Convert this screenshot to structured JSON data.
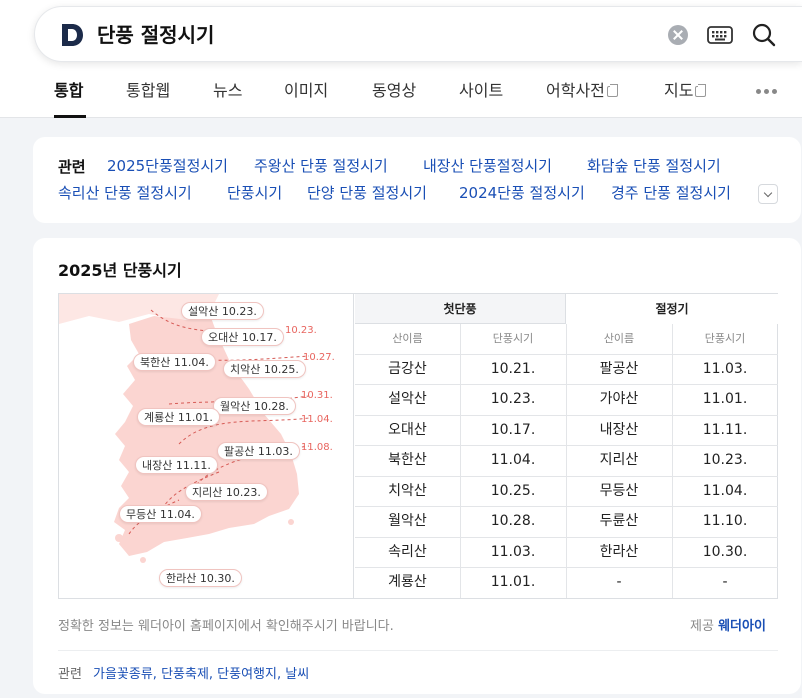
{
  "search": {
    "query": "단풍 절정시기"
  },
  "tabs": [
    {
      "label": "통합"
    },
    {
      "label": "통합웹"
    },
    {
      "label": "뉴스"
    },
    {
      "label": "이미지"
    },
    {
      "label": "동영상"
    },
    {
      "label": "사이트"
    },
    {
      "label": "어학사전"
    },
    {
      "label": "지도"
    }
  ],
  "related": {
    "label": "관련",
    "links": [
      "2025단풍절정시기",
      "주왕산 단풍 절정시기",
      "내장산 단풍절정시기",
      "화담숲 단풍 절정시기",
      "속리산 단풍 절정시기",
      "단풍시기",
      "단양 단풍 절정시기",
      "2024단풍 절정시기",
      "경주 단풍 절정시기"
    ]
  },
  "foliage": {
    "title": "2025년 단풍시기",
    "map_pins": [
      "설악산 10.23.",
      "오대산 10.17.",
      "북한산 11.04.",
      "치악산 10.25.",
      "월악산 10.28.",
      "계룡산 11.01.",
      "팔공산 11.03.",
      "내장산 11.11.",
      "지리산 10.23.",
      "무등산 11.04.",
      "한라산 10.30."
    ],
    "isolines": [
      "10.23.",
      "10.27.",
      "10.31.",
      "11.04.",
      "11.08."
    ],
    "table": {
      "group_first": "첫단풍",
      "group_peak": "절정기",
      "col_mountain": "산이름",
      "col_date": "단풍시기",
      "rows": [
        {
          "m1": "금강산",
          "d1": "10.21.",
          "m2": "팔공산",
          "d2": "11.03."
        },
        {
          "m1": "설악산",
          "d1": "10.23.",
          "m2": "가야산",
          "d2": "11.01."
        },
        {
          "m1": "오대산",
          "d1": "10.17.",
          "m2": "내장산",
          "d2": "11.11."
        },
        {
          "m1": "북한산",
          "d1": "11.04.",
          "m2": "지리산",
          "d2": "10.23."
        },
        {
          "m1": "치악산",
          "d1": "10.25.",
          "m2": "무등산",
          "d2": "11.04."
        },
        {
          "m1": "월악산",
          "d1": "10.28.",
          "m2": "두륜산",
          "d2": "11.10."
        },
        {
          "m1": "속리산",
          "d1": "11.03.",
          "m2": "한라산",
          "d2": "10.30."
        },
        {
          "m1": "계룡산",
          "d1": "11.01.",
          "m2": "-",
          "d2": "-"
        }
      ]
    },
    "notice": "정확한 정보는 웨더아이 홈페이지에서 확인해주시기 바랍니다.",
    "provider_label": "제공",
    "provider_name": "웨더아이",
    "footer_label": "관련",
    "footer_links": "가을꽃종류, 단풍축제, 단풍여행지, 날씨"
  },
  "colors": {
    "brand": "#1c2b4a",
    "link": "#1a4fb5",
    "map_fill": "#fbd5d1",
    "isoline": "#e8655f"
  }
}
